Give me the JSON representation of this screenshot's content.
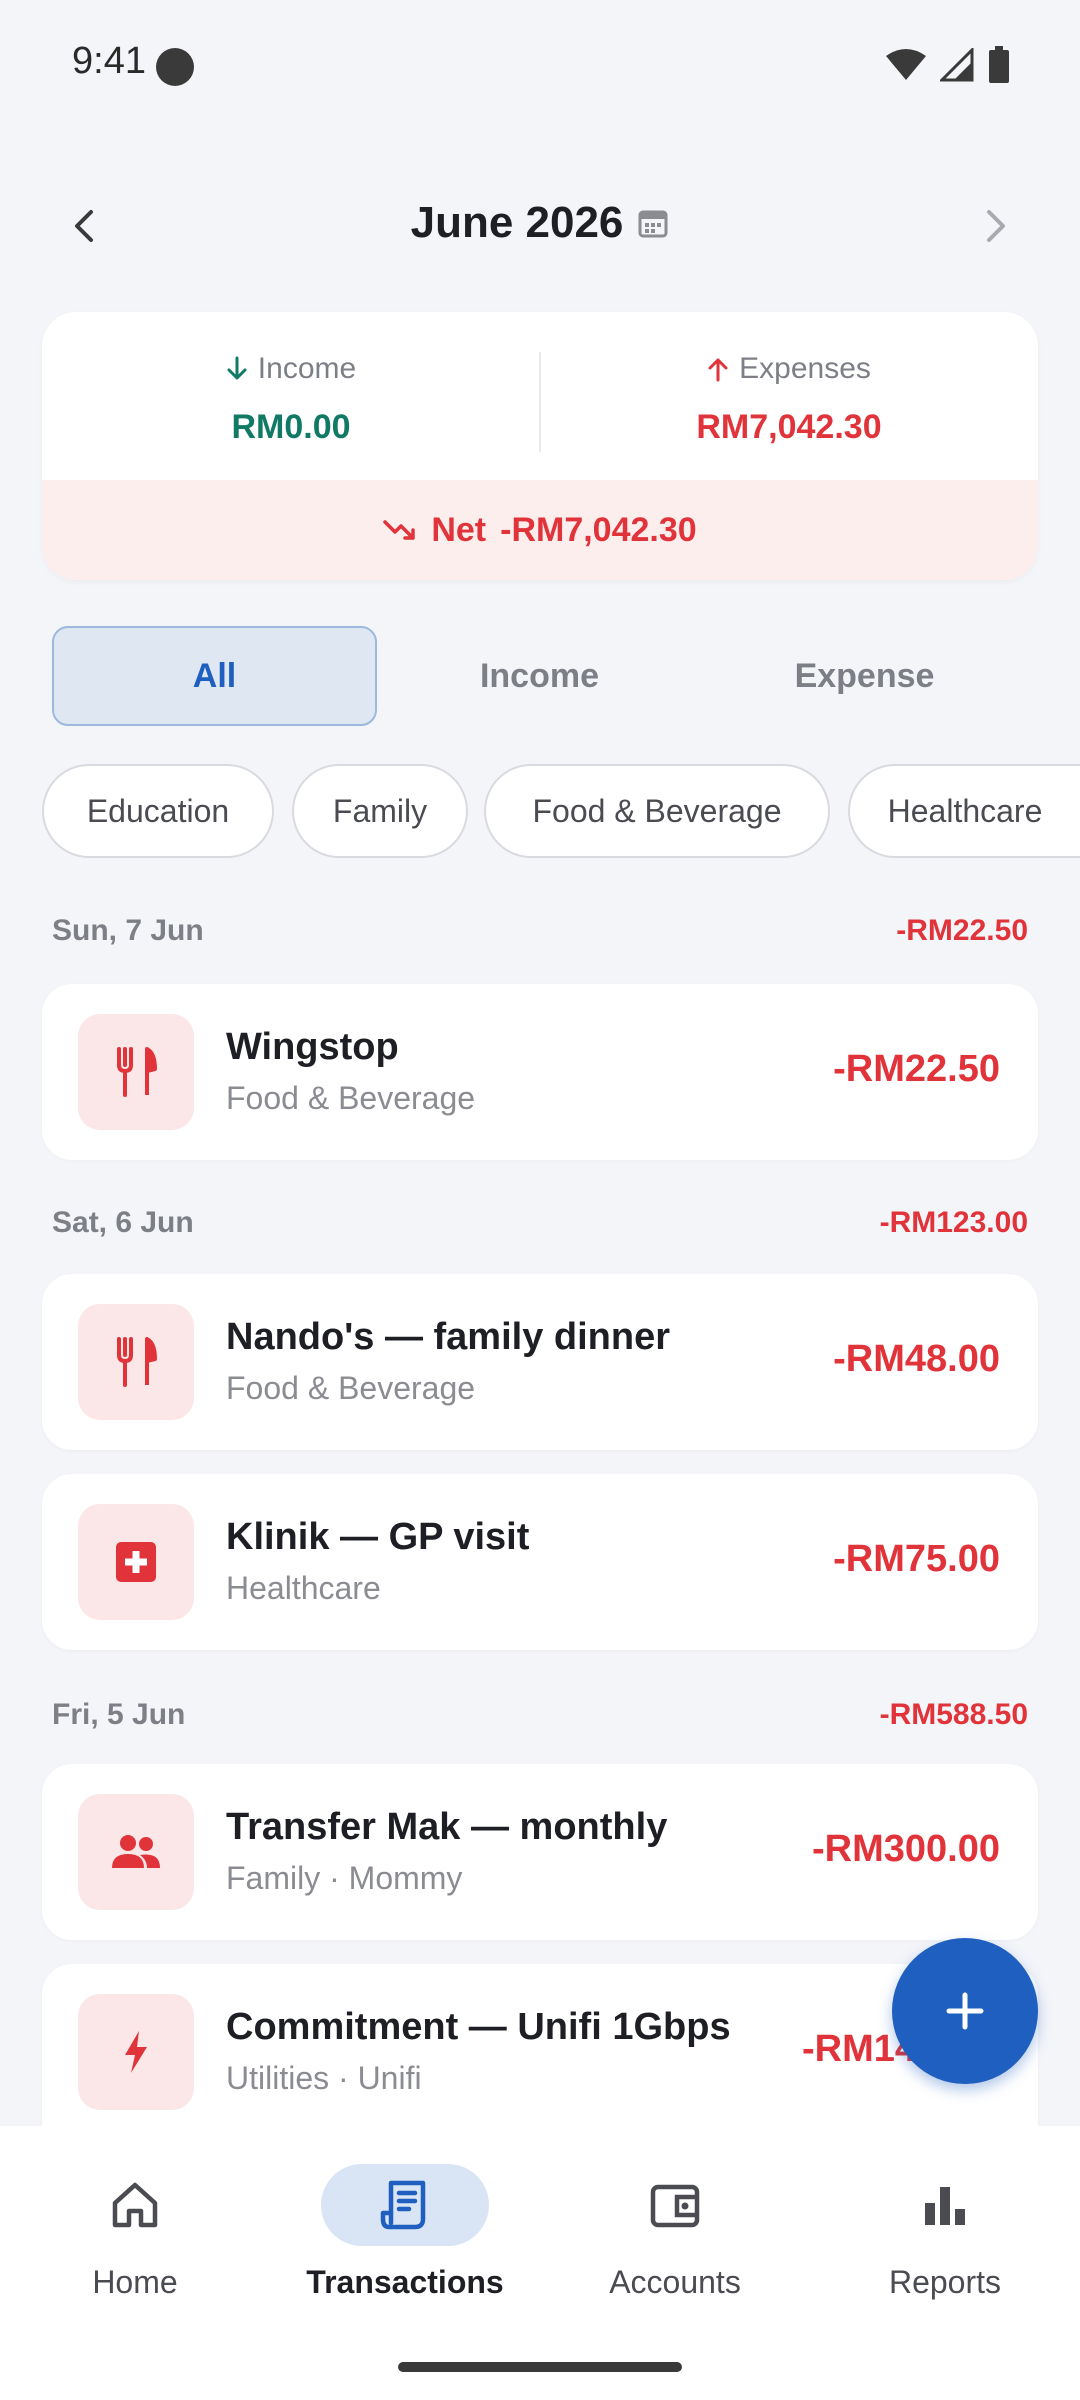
{
  "status": {
    "time": "9:41"
  },
  "header": {
    "month": "June 2026"
  },
  "summary": {
    "income_label": "Income",
    "income_amount": "RM0.00",
    "expenses_label": "Expenses",
    "expenses_amount": "RM7,042.30",
    "net_label": "Net",
    "net_amount": "-RM7,042.30"
  },
  "segments": [
    "All",
    "Income",
    "Expense"
  ],
  "chips": [
    "Education",
    "Family",
    "Food & Beverage",
    "Healthcare"
  ],
  "days": [
    {
      "label": "Sun, 7 Jun",
      "total": "-RM22.50"
    },
    {
      "label": "Sat, 6 Jun",
      "total": "-RM123.00"
    },
    {
      "label": "Fri, 5 Jun",
      "total": "-RM588.50"
    }
  ],
  "transactions": [
    {
      "title": "Wingstop",
      "subtitle": "Food & Beverage",
      "amount": "-RM22.50",
      "icon": "fork-knife-icon"
    },
    {
      "title": "Nando's — family dinner",
      "subtitle": "Food & Beverage",
      "amount": "-RM48.00",
      "icon": "fork-knife-icon"
    },
    {
      "title": "Klinik — GP visit",
      "subtitle": "Healthcare",
      "amount": "-RM75.00",
      "icon": "medical-cross-icon"
    },
    {
      "title": "Transfer Mak — monthly",
      "subtitle": "Family · Mommy",
      "amount": "-RM300.00",
      "icon": "people-icon"
    },
    {
      "title": "Commitment — Unifi 1Gbps",
      "subtitle": "Utilities · Unifi",
      "amount": "-RM14",
      "icon": "lightning-icon"
    }
  ],
  "nav": [
    "Home",
    "Transactions",
    "Accounts",
    "Reports"
  ],
  "colors": {
    "accent": "#1f5fbf",
    "expense": "#e0333a",
    "income": "#117a65"
  }
}
